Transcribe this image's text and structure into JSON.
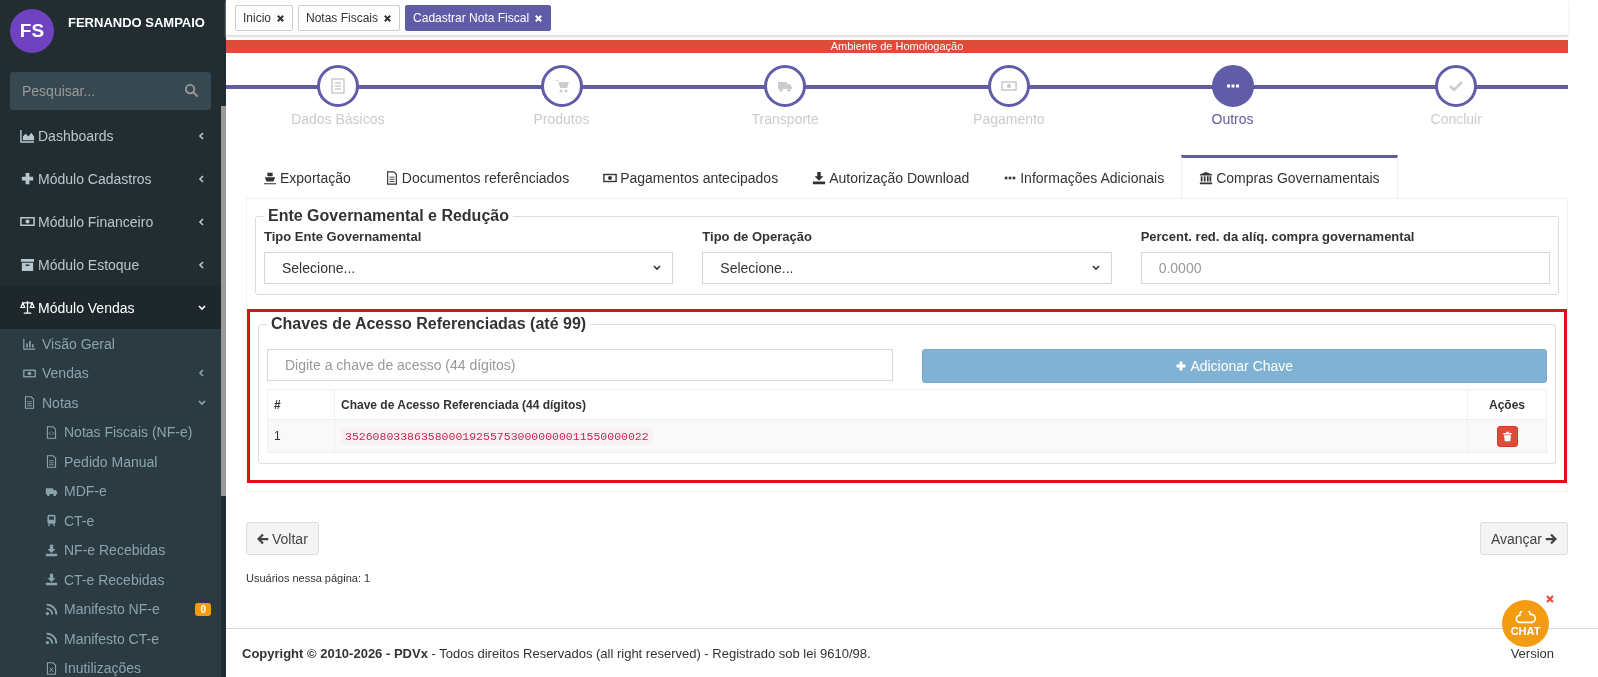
{
  "user": {
    "initials": "FS",
    "name": "FERNANDO SAMPAIO"
  },
  "search": {
    "placeholder": "Pesquisar..."
  },
  "menu": [
    {
      "label": "Dashboards",
      "expanded": false
    },
    {
      "label": "Módulo Cadastros",
      "expanded": false
    },
    {
      "label": "Módulo Financeiro",
      "expanded": false
    },
    {
      "label": "Módulo Estoque",
      "expanded": false
    },
    {
      "label": "Módulo Vendas",
      "expanded": true,
      "children": [
        {
          "label": "Visão Geral"
        },
        {
          "label": "Vendas",
          "expanded": false
        },
        {
          "label": "Notas",
          "expanded": true,
          "children": [
            {
              "label": "Notas Fiscais (NF-e)"
            },
            {
              "label": "Pedido Manual"
            },
            {
              "label": "MDF-e"
            },
            {
              "label": "CT-e"
            },
            {
              "label": "NF-e Recebidas"
            },
            {
              "label": "CT-e Recebidas"
            },
            {
              "label": "Manifesto NF-e",
              "badge": "0"
            },
            {
              "label": "Manifesto CT-e"
            },
            {
              "label": "Inutilizações"
            }
          ]
        }
      ]
    }
  ],
  "page_tabs": [
    {
      "label": "Inicio",
      "selected": false
    },
    {
      "label": "Notas Fiscais",
      "selected": false
    },
    {
      "label": "Cadastrar Nota Fiscal",
      "selected": true
    }
  ],
  "banner": "Ambiente de Homologação",
  "steps": [
    {
      "label": "Dados Básicos",
      "selected": false
    },
    {
      "label": "Produtos",
      "selected": false
    },
    {
      "label": "Transporte",
      "selected": false
    },
    {
      "label": "Pagamento",
      "selected": false
    },
    {
      "label": "Outros",
      "selected": true
    },
    {
      "label": "Concluir",
      "selected": false
    }
  ],
  "section_tabs": [
    {
      "label": "Exportação",
      "selected": false
    },
    {
      "label": "Documentos referênciados",
      "selected": false
    },
    {
      "label": "Pagamentos antecipados",
      "selected": false
    },
    {
      "label": "Autorização Download",
      "selected": false
    },
    {
      "label": "Informações Adicionais",
      "selected": false
    },
    {
      "label": "Compras Governamentais",
      "selected": true
    }
  ],
  "government": {
    "legend": "Ente Governamental e Redução",
    "fields": [
      {
        "kind": "select",
        "label": "Tipo Ente Governamental",
        "value": "Selecione..."
      },
      {
        "kind": "select",
        "label": "Tipo de Operação",
        "value": "Selecione..."
      },
      {
        "kind": "input",
        "label": "Percent. red. da alíq. compra governamental",
        "placeholder": "0.0000"
      }
    ]
  },
  "keys": {
    "legend": "Chaves de Acesso Referenciadas (até 99)",
    "placeholder": "Digite a chave de acesso (44 dígitos)",
    "add_button": "Adicionar Chave",
    "columns": [
      "#",
      "Chave de Acesso Referenciada (44 dígitos)",
      "Ações"
    ],
    "rows": [
      {
        "number": "1",
        "key": "35260803386358000192557530000000011550000022"
      }
    ]
  },
  "back_button": "Voltar",
  "next_button": "Avançar",
  "users_online": "Usuários nessa página: 1",
  "footer": {
    "copyright": "**Copyright © 2010-2026 - PDVx** - Todos direitos Reservados (all right reserved) - Registrado sob lei 9610/98.",
    "version": "Version"
  },
  "chat": {
    "label": "CHAT"
  }
}
